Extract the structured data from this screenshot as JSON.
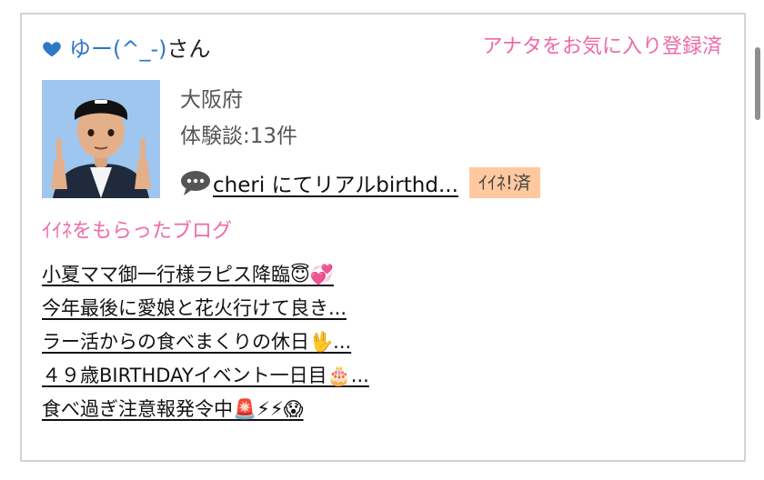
{
  "header": {
    "heart_icon": "heart-icon",
    "user_name": "ゆー(^_-)",
    "user_suffix": "さん",
    "favorite_status": "アナタをお気に入り登録済"
  },
  "profile": {
    "avatar_icon": "avatar",
    "location": "大阪府",
    "experience_count": "体験談:13件",
    "review_icon": "speech-bubble-icon",
    "review_link": "cheri にてリアルbirthd...",
    "like_badge": "ｲｲﾈ!済"
  },
  "blog": {
    "title": "ｲｲﾈをもらったブログ",
    "items": [
      "小夏ママ御一行様ラピス降臨😇💞",
      "今年最後に愛娘と花火行けて良き...",
      "ラー活からの食べまくりの休日🖖...",
      "４９歳BIRTHDAYイベント一日目🎂...",
      "食べ過ぎ注意報発令中🚨⚡⚡😱"
    ]
  },
  "colors": {
    "accent_pink": "#ef6aa8",
    "link_blue": "#2f78c6",
    "badge_orange": "#ffc89e",
    "border_gray": "#d3d3d3"
  }
}
